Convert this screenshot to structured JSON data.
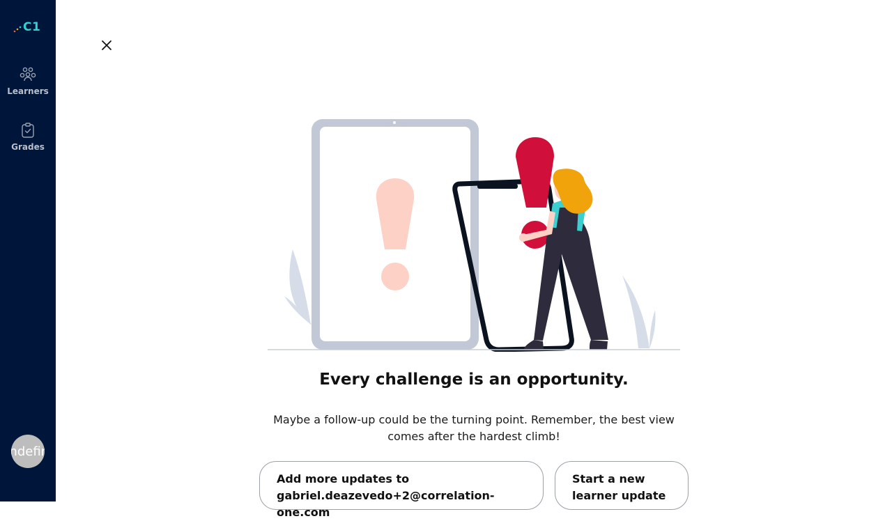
{
  "sidebar": {
    "logo_text": "C1",
    "items": [
      {
        "label": "Learners",
        "icon": "learners-icon"
      },
      {
        "label": "Grades",
        "icon": "clipboard-check-icon"
      }
    ],
    "avatar_text": "undefined"
  },
  "main": {
    "close_icon": "close-icon",
    "illustration": "warning-illustration",
    "title": "Every challenge is an opportunity.",
    "description": "Maybe a follow-up could be the turning point. Remember, the best view comes after the hardest climb!",
    "buttons": {
      "add_more": "Add more updates to gabriel.deazevedo+2@correlation-one.com",
      "start_new": "Start a new learner update"
    }
  },
  "colors": {
    "sidebar_bg": "#00153a",
    "accent": "#2fd3d3",
    "alert_red": "#d0103a"
  }
}
